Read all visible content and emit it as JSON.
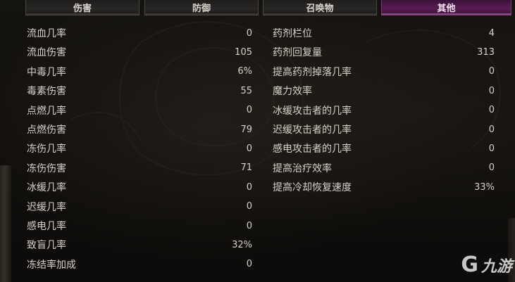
{
  "tabs": [
    {
      "label": "伤害",
      "active": false
    },
    {
      "label": "防御",
      "active": false
    },
    {
      "label": "召唤物",
      "active": false
    },
    {
      "label": "其他",
      "active": true
    }
  ],
  "left_stats": [
    {
      "label": "流血几率",
      "value": "0"
    },
    {
      "label": "流血伤害",
      "value": "105"
    },
    {
      "label": "中毒几率",
      "value": "6%"
    },
    {
      "label": "毒素伤害",
      "value": "55"
    },
    {
      "label": "点燃几率",
      "value": "0"
    },
    {
      "label": "点燃伤害",
      "value": "79"
    },
    {
      "label": "冻伤几率",
      "value": "0"
    },
    {
      "label": "冻伤伤害",
      "value": "71"
    },
    {
      "label": "冰缓几率",
      "value": "0"
    },
    {
      "label": "迟缓几率",
      "value": "0"
    },
    {
      "label": "感电几率",
      "value": "0"
    },
    {
      "label": "致盲几率",
      "value": "32%"
    },
    {
      "label": "冻结率加成",
      "value": "0"
    }
  ],
  "right_stats": [
    {
      "label": "药剂栏位",
      "value": "4"
    },
    {
      "label": "药剂回复量",
      "value": "313"
    },
    {
      "label": "提高药剂掉落几率",
      "value": "0"
    },
    {
      "label": "魔力效率",
      "value": "0"
    },
    {
      "label": "冰缓攻击者的几率",
      "value": "0"
    },
    {
      "label": "迟缓攻击者的几率",
      "value": "0"
    },
    {
      "label": "感电攻击者的几率",
      "value": "0"
    },
    {
      "label": "提高治疗效率",
      "value": "0"
    },
    {
      "label": "提高冷却恢复速度",
      "value": "33%"
    }
  ],
  "watermark": {
    "glyph": "G",
    "text": "九游"
  },
  "colors": {
    "text": "#d6d2ca",
    "active_tab": "#5a1c56",
    "inactive_tab": "#2a2826",
    "background": "#100e0c"
  }
}
